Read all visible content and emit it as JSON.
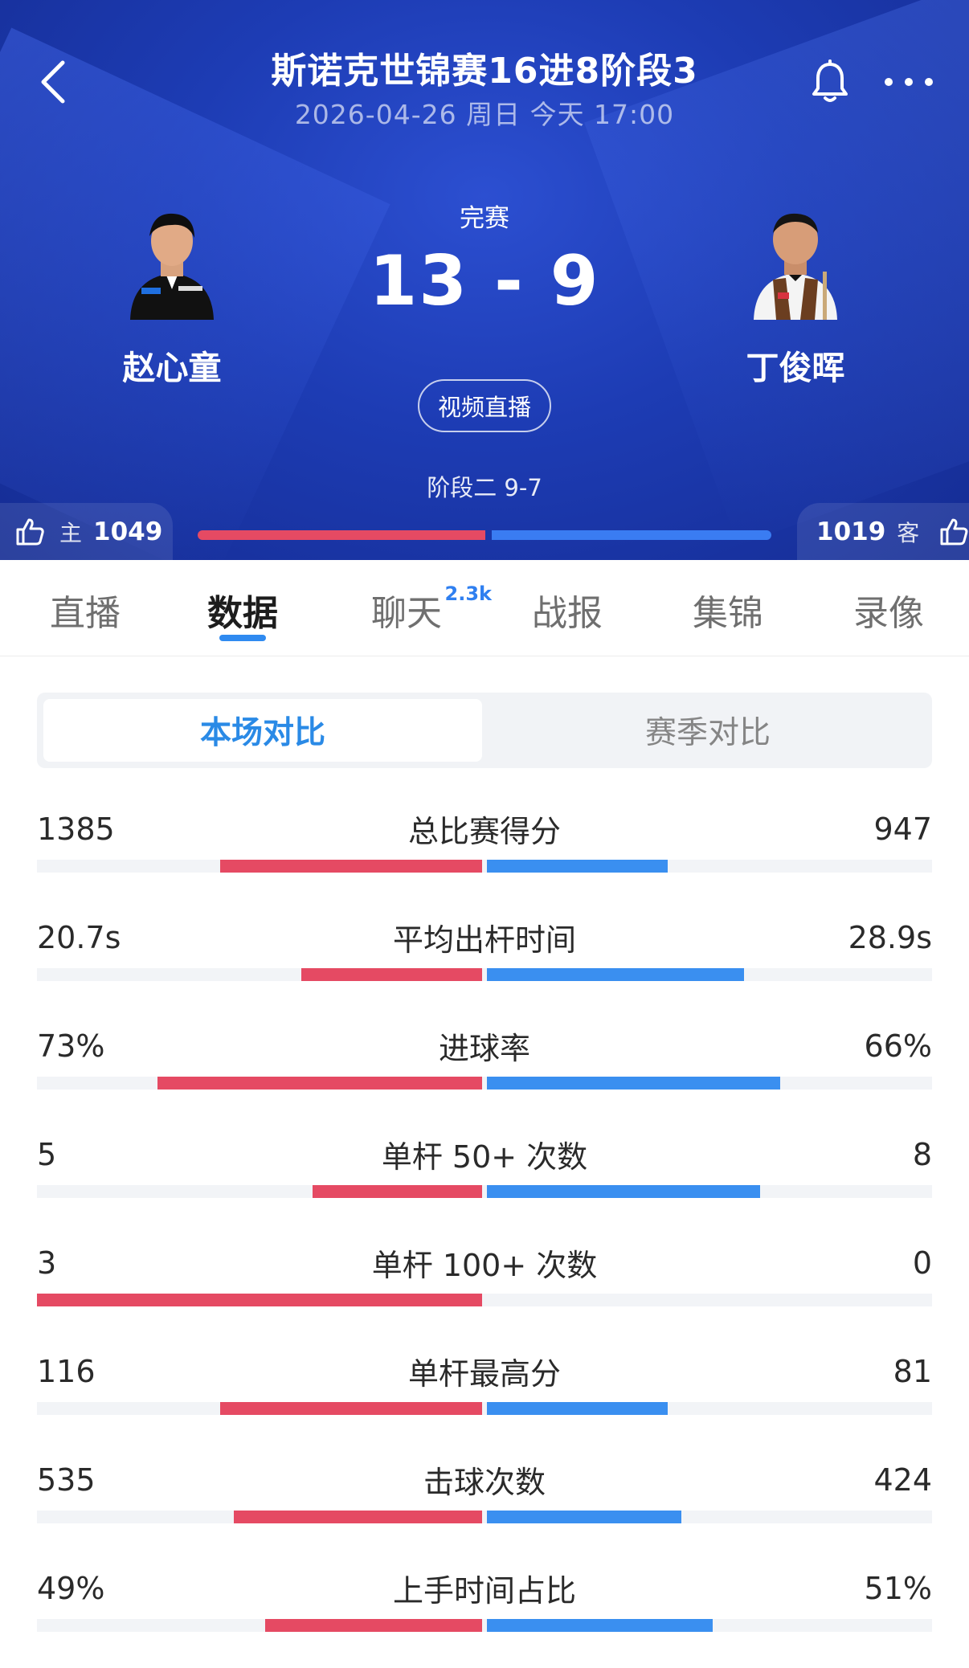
{
  "header": {
    "title": "斯诺克世锦赛16进8阶段3",
    "datetime": "2026-04-26 周日 今天 17:00",
    "status": "完赛",
    "score": "13 - 9",
    "video_button": "视频直播",
    "phase_score": "阶段二 9-7",
    "home_player": "赵心童",
    "away_player": "丁俊晖",
    "home_like_label": "主",
    "home_like_count": "1049",
    "away_like_label": "客",
    "away_like_count": "1019",
    "support_home_fraction": 0.507,
    "colors": {
      "home": "#e54a63",
      "away": "#3a7cf2",
      "bg": "#1d3cb4"
    }
  },
  "tabs": [
    {
      "label": "直播"
    },
    {
      "label": "数据",
      "active": true
    },
    {
      "label": "聊天",
      "badge": "2.3k"
    },
    {
      "label": "战报"
    },
    {
      "label": "集锦"
    },
    {
      "label": "录像"
    }
  ],
  "toggle": {
    "active": "本场对比",
    "inactive": "赛季对比"
  },
  "stats": [
    {
      "label": "总比赛得分",
      "home": "1385",
      "away": "947",
      "home_ratio": 0.59,
      "away_ratio": 0.41
    },
    {
      "label": "平均出杆时间",
      "home": "20.7s",
      "away": "28.9s",
      "home_ratio": 0.41,
      "away_ratio": 0.58
    },
    {
      "label": "进球率",
      "home": "73%",
      "away": "66%",
      "home_ratio": 0.73,
      "away_ratio": 0.66
    },
    {
      "label": "单杆 50+ 次数",
      "home": "5",
      "away": "8",
      "home_ratio": 0.385,
      "away_ratio": 0.615
    },
    {
      "label": "单杆 100+ 次数",
      "home": "3",
      "away": "0",
      "home_ratio": 1.0,
      "away_ratio": 0.0
    },
    {
      "label": "单杆最高分",
      "home": "116",
      "away": "81",
      "home_ratio": 0.59,
      "away_ratio": 0.41
    },
    {
      "label": "击球次数",
      "home": "535",
      "away": "424",
      "home_ratio": 0.56,
      "away_ratio": 0.44
    },
    {
      "label": "上手时间占比",
      "home": "49%",
      "away": "51%",
      "home_ratio": 0.49,
      "away_ratio": 0.51
    }
  ]
}
